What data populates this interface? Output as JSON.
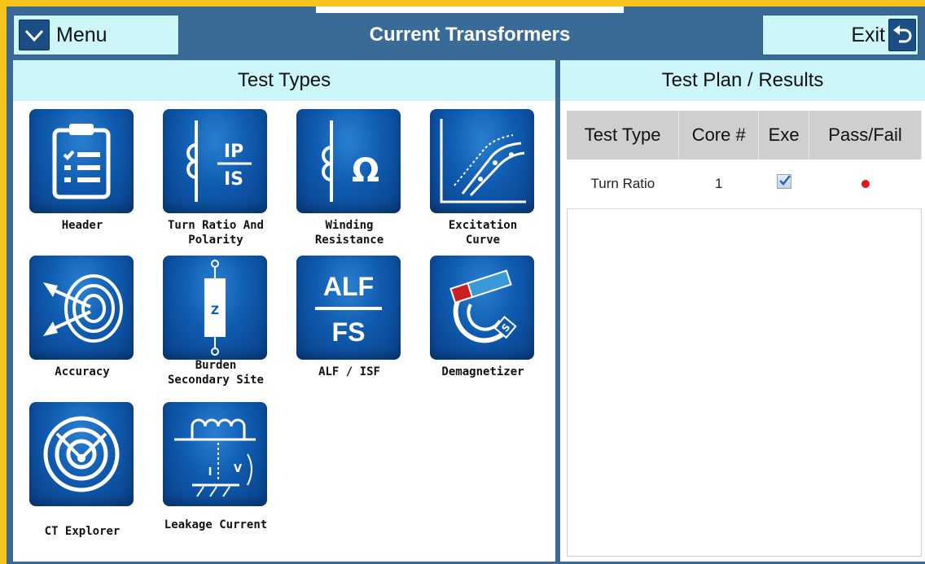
{
  "header": {
    "menu_label": "Menu",
    "title": "Current Transformers",
    "exit_label": "Exit"
  },
  "test_types": {
    "heading": "Test Types",
    "tiles": [
      {
        "label": "Header",
        "icon": "clipboard-checklist-icon"
      },
      {
        "label": "Turn Ratio And Polarity",
        "icon": "ct-ratio-icon",
        "icon_text_top": "IP",
        "icon_text_bottom": "IS"
      },
      {
        "label": "Winding Resistance",
        "icon": "winding-ohm-icon",
        "icon_text": "Ω"
      },
      {
        "label": "Excitation Curve",
        "icon": "excitation-curve-icon"
      },
      {
        "label": "Accuracy",
        "icon": "target-arrows-icon"
      },
      {
        "label": "Burden Secondary Site",
        "icon": "burden-impedance-icon",
        "icon_text": "Z"
      },
      {
        "label": "ALF / ISF",
        "icon": "alf-fs-icon",
        "icon_text_top": "ALF",
        "icon_text_bottom": "FS"
      },
      {
        "label": "Demagnetizer",
        "icon": "magnet-icon",
        "icon_text": "S"
      },
      {
        "label": "CT Explorer",
        "icon": "radar-icon"
      },
      {
        "label": "Leakage Current",
        "icon": "leakage-current-icon",
        "icon_text_i": "I",
        "icon_text_v": "V"
      }
    ]
  },
  "results": {
    "heading": "Test Plan / Results",
    "columns": [
      "Test Type",
      "Core #",
      "Exe",
      "Pass/Fail"
    ],
    "rows": [
      {
        "test_type": "Turn Ratio",
        "core": "1",
        "exe_checked": true,
        "status_color": "#e01515"
      }
    ]
  },
  "colors": {
    "frame": "#f7c31c",
    "bar": "#3a6a96",
    "header_bg": "#cdf6fb",
    "tile_blue": "#0f5bb0"
  }
}
